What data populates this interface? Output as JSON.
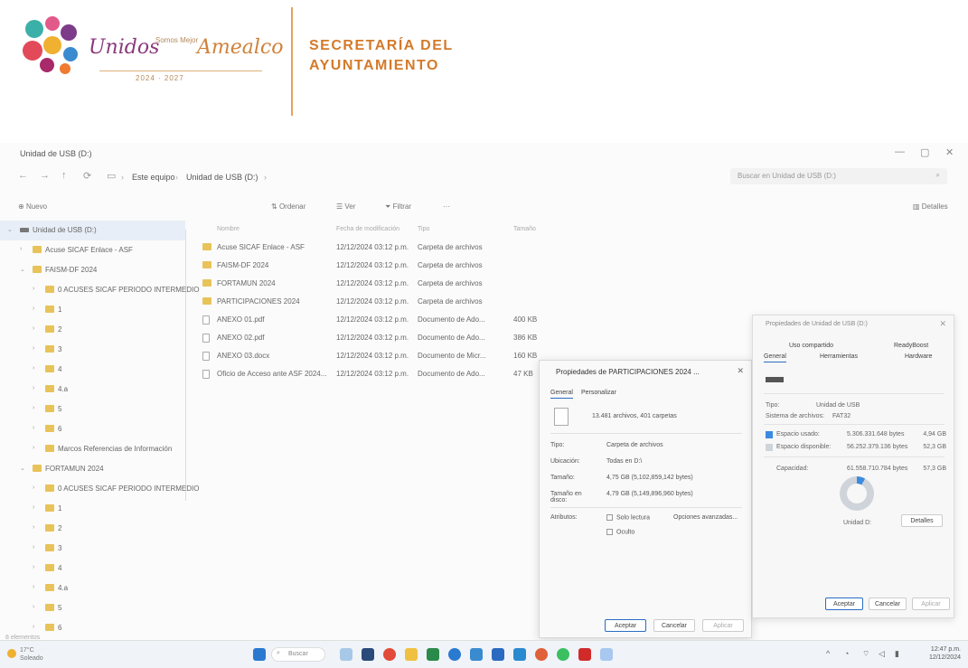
{
  "letterhead": {
    "script_unidos": "Unidos",
    "script_mejor": "Somos Mejor",
    "script_town": "Amealco",
    "years": "2024 · 2027",
    "dept_line1": "SECRETARÍA DEL",
    "dept_line2": "AYUNTAMIENTO"
  },
  "explorer": {
    "title": "Unidad de USB (D:)",
    "breadcrumb": [
      "Este equipo",
      "Unidad de USB (D:)"
    ],
    "search_placeholder": "Buscar en Unidad de USB (D:)",
    "commands": {
      "new": "Nuevo",
      "sort": "Ordenar",
      "view": "Ver",
      "filter": "Filtrar",
      "more": "···",
      "details": "Detalles"
    },
    "columns": [
      "Nombre",
      "Fecha de modificación",
      "Tipo",
      "Tamaño"
    ],
    "nav_items": [
      {
        "label": "Unidad de USB (D:)",
        "level": 0,
        "expanded": true,
        "selected": true
      },
      {
        "label": "Acuse SICAF Enlace - ASF",
        "level": 1,
        "expanded": false
      },
      {
        "label": "FAISM-DF 2024",
        "level": 1,
        "expanded": true
      },
      {
        "label": "0 ACUSES SICAF PERIODO INTERMEDIO",
        "level": 2,
        "expanded": false
      },
      {
        "label": "1",
        "level": 2,
        "expanded": false
      },
      {
        "label": "2",
        "level": 2,
        "expanded": false
      },
      {
        "label": "3",
        "level": 2,
        "expanded": false
      },
      {
        "label": "4",
        "level": 2,
        "expanded": false
      },
      {
        "label": "4.a",
        "level": 2,
        "expanded": false
      },
      {
        "label": "5",
        "level": 2,
        "expanded": false
      },
      {
        "label": "6",
        "level": 2,
        "expanded": false
      },
      {
        "label": "Marcos Referencias de Información",
        "level": 2,
        "expanded": false
      },
      {
        "label": "FORTAMUN 2024",
        "level": 1,
        "expanded": true
      },
      {
        "label": "0 ACUSES SICAF PERIODO INTERMEDIO",
        "level": 2,
        "expanded": false
      },
      {
        "label": "1",
        "level": 2,
        "expanded": false
      },
      {
        "label": "2",
        "level": 2,
        "expanded": false
      },
      {
        "label": "3",
        "level": 2,
        "expanded": false
      },
      {
        "label": "4",
        "level": 2,
        "expanded": false
      },
      {
        "label": "4.a",
        "level": 2,
        "expanded": false
      },
      {
        "label": "5",
        "level": 2,
        "expanded": false
      },
      {
        "label": "6",
        "level": 2,
        "expanded": false
      }
    ],
    "files": [
      {
        "name": "Acuse SICAF Enlace - ASF",
        "modified": "12/12/2024 03:12 p.m.",
        "type": "Carpeta de archivos",
        "size": "",
        "kind": "folder"
      },
      {
        "name": "FAISM-DF 2024",
        "modified": "12/12/2024 03:12 p.m.",
        "type": "Carpeta de archivos",
        "size": "",
        "kind": "folder"
      },
      {
        "name": "FORTAMUN 2024",
        "modified": "12/12/2024 03:12 p.m.",
        "type": "Carpeta de archivos",
        "size": "",
        "kind": "folder"
      },
      {
        "name": "PARTICIPACIONES 2024",
        "modified": "12/12/2024 03:12 p.m.",
        "type": "Carpeta de archivos",
        "size": "",
        "kind": "folder"
      },
      {
        "name": "ANEXO 01.pdf",
        "modified": "12/12/2024 03:12 p.m.",
        "type": "Documento de Ado...",
        "size": "400 KB",
        "kind": "doc"
      },
      {
        "name": "ANEXO 02.pdf",
        "modified": "12/12/2024 03:12 p.m.",
        "type": "Documento de Ado...",
        "size": "386 KB",
        "kind": "doc"
      },
      {
        "name": "ANEXO 03.docx",
        "modified": "12/12/2024 03:12 p.m.",
        "type": "Documento de Micr...",
        "size": "160 KB",
        "kind": "doc"
      },
      {
        "name": "Oficio de Acceso ante ASF 2024...",
        "modified": "12/12/2024 03:12 p.m.",
        "type": "Documento de Ado...",
        "size": "47 KB",
        "kind": "doc"
      }
    ],
    "status": "8 elementos"
  },
  "dialog_folder": {
    "title": "Propiedades de PARTICIPACIONES 2024 ...",
    "tabs": [
      "General",
      "Personalizar"
    ],
    "contents": "13.481 archivos, 401 carpetas",
    "props": [
      {
        "k": "Tipo:",
        "v": "Carpeta de archivos"
      },
      {
        "k": "Ubicación:",
        "v": "Todas en D:\\"
      },
      {
        "k": "Tamaño:",
        "v": "4,75 GB (5,102,859,142 bytes)"
      },
      {
        "k": "Tamaño en disco:",
        "v": "4,79 GB (5,149,896,960 bytes)"
      }
    ],
    "attributes_label": "Atributos:",
    "readonly_label": "Solo lectura",
    "hidden_label": "Oculto",
    "advanced_label": "Opciones avanzadas...",
    "buttons": {
      "ok": "Aceptar",
      "cancel": "Cancelar",
      "apply": "Aplicar"
    }
  },
  "dialog_drive": {
    "title": "Propiedades de Unidad de USB (D:)",
    "tabs_row1": [
      "Uso compartido",
      "ReadyBoost"
    ],
    "tabs_row2": [
      "General",
      "Herramientas",
      "Hardware"
    ],
    "type_label": "Tipo:",
    "type_value": "Unidad de USB",
    "fs_label": "Sistema de archivos:",
    "fs_value": "FAT32",
    "used_label": "Espacio usado:",
    "used_bytes": "5.306.331.648 bytes",
    "used_gb": "4,94 GB",
    "free_label": "Espacio disponible:",
    "free_bytes": "56.252.379.136 bytes",
    "free_gb": "52,3 GB",
    "cap_label": "Capacidad:",
    "cap_bytes": "61.558.710.784 bytes",
    "cap_gb": "57,3 GB",
    "used_fraction": 0.08,
    "drive_label": "Unidad D:",
    "details_btn": "Detalles",
    "buttons": {
      "ok": "Aceptar",
      "cancel": "Cancelar",
      "apply": "Aplicar"
    },
    "colors": {
      "used": "#3c8be0",
      "free": "#cfd4da"
    }
  },
  "taskbar": {
    "weather_temp": "17°C",
    "weather_desc": "Soleado",
    "search_label": "Buscar",
    "time": "12:47 p.m.",
    "date": "12/12/2024"
  }
}
